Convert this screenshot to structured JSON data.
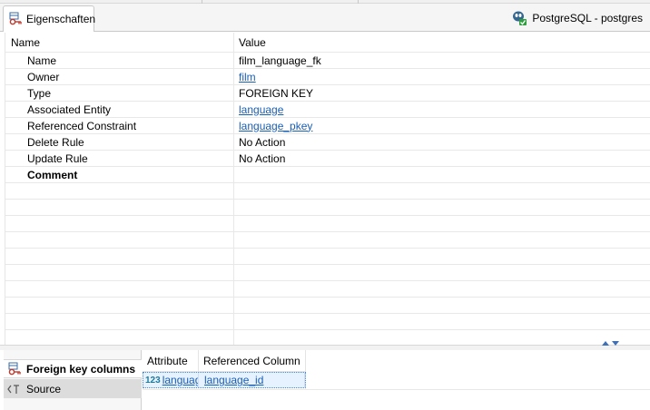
{
  "tab": {
    "label": "Eigenschaften"
  },
  "connection": {
    "label": "PostgreSQL - postgres"
  },
  "grid": {
    "headers": {
      "name": "Name",
      "value": "Value"
    },
    "rows": [
      {
        "name": "Name",
        "value": "film_language_fk",
        "link": false
      },
      {
        "name": "Owner",
        "value": "film",
        "link": true
      },
      {
        "name": "Type",
        "value": "FOREIGN KEY",
        "link": false
      },
      {
        "name": "Associated Entity",
        "value": "language",
        "link": true
      },
      {
        "name": "Referenced Constraint",
        "value": "language_pkey",
        "link": true
      },
      {
        "name": "Delete Rule",
        "value": "No Action",
        "link": false
      },
      {
        "name": "Update Rule",
        "value": "No Action",
        "link": false
      },
      {
        "name": "Comment",
        "value": "",
        "link": false,
        "bold": true
      }
    ]
  },
  "side_tabs": [
    {
      "label": "Foreign key columns",
      "icon": "foreign-key-icon"
    },
    {
      "label": "Source",
      "icon": "source-icon"
    }
  ],
  "fk_table": {
    "headers": {
      "attribute": "Attribute",
      "referenced": "Referenced Column"
    },
    "rows": [
      {
        "type_badge": "123",
        "attribute": "language_id",
        "referenced": "language_id"
      }
    ]
  },
  "colors": {
    "link": "#1a5fb4",
    "selection": "#e6f2ff",
    "accent": "#3f6fb5"
  }
}
